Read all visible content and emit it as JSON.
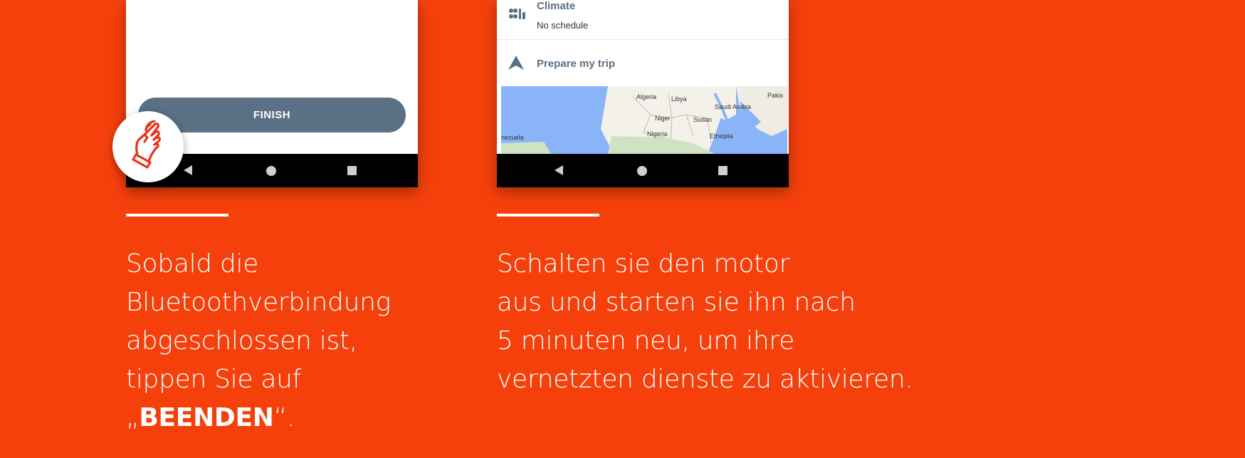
{
  "left_panel": {
    "finish_button_label": "FINISH",
    "caption_lines": [
      "Sobald die",
      "Bluetoothverbindung",
      "abgeschlossen ist,",
      "tippen Sie auf"
    ],
    "caption_last_prefix": "„",
    "caption_last_bold": "BEENDEN",
    "caption_last_suffix": "“."
  },
  "right_panel": {
    "climate_title": "Climate",
    "climate_subtitle": "No schedule",
    "prepare_trip_label": "Prepare my trip",
    "map_labels": {
      "algeria": "Algeria",
      "libya": "Libya",
      "saudi_arabia": "Saudi Arabia",
      "pakis": "Pakis",
      "niger": "Niger",
      "sudan": "Sudan",
      "nigeria": "Nigeria",
      "ethiopia": "Ethiopia",
      "venezuela": "nezuela"
    },
    "caption_lines": [
      "Schalten sie den motor",
      "aus und starten sie ihn nach",
      "5 minuten neu, um ihre",
      "vernetzten dienste zu aktivieren."
    ]
  },
  "icons": {
    "hand": "pointing-hand-icon",
    "climate": "climate-fan-icon",
    "trip": "navigation-arrow-icon",
    "back": "back-triangle-icon",
    "home": "home-circle-icon",
    "recent": "recent-square-icon"
  },
  "colors": {
    "background": "#f5400c",
    "button": "#5a7085",
    "accent_red": "#e8321b"
  }
}
